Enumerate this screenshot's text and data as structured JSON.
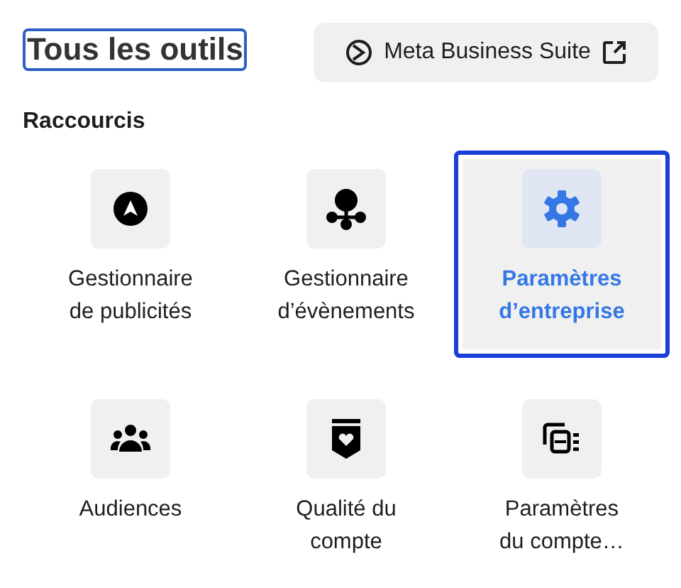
{
  "header": {
    "title": "Tous les outils",
    "title_focused": true,
    "button": "Meta Business Suite"
  },
  "section": "Raccourcis",
  "shortcuts": [
    {
      "label": "Gestionnaire\nde publicités",
      "selected": false
    },
    {
      "label": "Gestionnaire\nd’évènements",
      "selected": false
    },
    {
      "label": "Paramètres\nd’entreprise",
      "selected": true
    },
    {
      "label": "Audiences",
      "selected": false
    },
    {
      "label": "Qualité du\ncompte",
      "selected": false
    },
    {
      "label": "Paramètres\n du compte…",
      "selected": false
    }
  ]
}
